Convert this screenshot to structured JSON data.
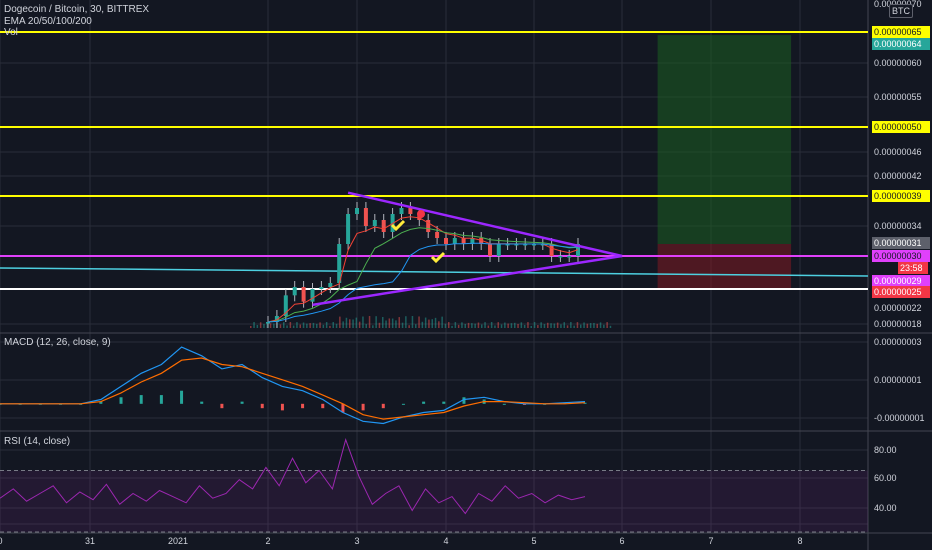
{
  "header": {
    "title": "Dogecoin / Bitcoin, 30, BITTREX",
    "vol_label": "Vol",
    "ema_label": "EMA 20/50/100/200",
    "currency": "BTC"
  },
  "indicators": {
    "macd_label": "MACD (12, 26, close, 9)",
    "rsi_label": "RSI (14, close)"
  },
  "colors": {
    "background": "#131722",
    "grid": "#2a2e39",
    "yellow_level": "#ffff00",
    "magenta_level": "#e040fb",
    "white_level": "#ffffff",
    "cyan_level": "#4dd0e1",
    "triangle": "#9c27ff",
    "macd_line": "#2196f3",
    "signal_line": "#ff6d00",
    "rsi_line": "#9c27b0",
    "profit_zone": "#1b5e20",
    "loss_zone": "#801922"
  },
  "chart_data": [
    {
      "type": "line",
      "pane": "price",
      "title": "Dogecoin / Bitcoin, 30, BITTREX",
      "x_ticks": [
        "0",
        "31",
        "2021",
        "2",
        "3",
        "4",
        "5",
        "6",
        "7",
        "8"
      ],
      "y_ticks": [
        "0.00000070",
        "0.00000060",
        "0.00000055",
        "0.00000046",
        "0.00000042",
        "0.00000034",
        "0.00000022",
        "0.00000018"
      ],
      "ylim": [
        1.8e-07,
        7e-07
      ],
      "horizontal_levels": [
        {
          "value": 6.5e-07,
          "label": "0.00000065",
          "color": "#ffff00"
        },
        {
          "value": 5e-07,
          "label": "0.00000050",
          "color": "#ffff00"
        },
        {
          "value": 3.9e-07,
          "label": "0.00000039",
          "color": "#ffff00"
        },
        {
          "value": 3e-07,
          "label": "0.00000030",
          "color": "#e040fb"
        },
        {
          "value": 2.5e-07,
          "label": "0.00000025",
          "color": "#ffffff"
        }
      ],
      "price_tags": [
        {
          "label": "0.00000064",
          "color": "#26a69a"
        },
        {
          "label": "0.00000031",
          "color": "#5d606b"
        },
        {
          "label": "0.00000030",
          "color": "#f23645"
        },
        {
          "label": "23:58",
          "color": "#f23645"
        },
        {
          "label": "0.00000029",
          "color": "#e040fb"
        },
        {
          "label": "0.00000025",
          "color": "#f23645"
        }
      ],
      "price_series": [
        {
          "x": 2.0,
          "y": 1.85e-07
        },
        {
          "x": 2.1,
          "y": 2e-07
        },
        {
          "x": 2.2,
          "y": 2.4e-07
        },
        {
          "x": 2.3,
          "y": 2.6e-07
        },
        {
          "x": 2.4,
          "y": 2.3e-07
        },
        {
          "x": 2.5,
          "y": 2.5e-07
        },
        {
          "x": 2.6,
          "y": 2.6e-07
        },
        {
          "x": 2.7,
          "y": 2.8e-07
        },
        {
          "x": 2.8,
          "y": 3.1e-07
        },
        {
          "x": 2.9,
          "y": 3.6e-07
        },
        {
          "x": 3.0,
          "y": 3.7e-07
        },
        {
          "x": 3.1,
          "y": 3.4e-07
        },
        {
          "x": 3.2,
          "y": 3.5e-07
        },
        {
          "x": 3.3,
          "y": 3.3e-07
        },
        {
          "x": 3.4,
          "y": 3.6e-07
        },
        {
          "x": 3.5,
          "y": 3.7e-07
        },
        {
          "x": 3.6,
          "y": 3.6e-07
        },
        {
          "x": 3.7,
          "y": 3.5e-07
        },
        {
          "x": 3.8,
          "y": 3.3e-07
        },
        {
          "x": 3.9,
          "y": 3.2e-07
        },
        {
          "x": 4.0,
          "y": 3.1e-07
        },
        {
          "x": 4.1,
          "y": 3.2e-07
        },
        {
          "x": 4.2,
          "y": 3.1e-07
        },
        {
          "x": 4.3,
          "y": 3.2e-07
        },
        {
          "x": 4.4,
          "y": 3.1e-07
        },
        {
          "x": 4.5,
          "y": 3e-07
        },
        {
          "x": 4.6,
          "y": 3.1e-07
        },
        {
          "x": 4.7,
          "y": 3.1e-07
        },
        {
          "x": 4.8,
          "y": 3.1e-07
        },
        {
          "x": 4.9,
          "y": 3.1e-07
        },
        {
          "x": 5.0,
          "y": 3.1e-07
        },
        {
          "x": 5.1,
          "y": 3.1e-07
        },
        {
          "x": 5.2,
          "y": 3e-07
        },
        {
          "x": 5.3,
          "y": 3e-07
        },
        {
          "x": 5.4,
          "y": 3e-07
        },
        {
          "x": 5.5,
          "y": 3.1e-07
        }
      ],
      "triangle": [
        {
          "x": 2.9,
          "y": 3.95e-07
        },
        {
          "x": 6.0,
          "y": 3e-07
        },
        {
          "x": 2.5,
          "y": 2.25e-07
        }
      ],
      "target_zone": {
        "x_start": 6.4,
        "x_end": 7.9,
        "top": 6.45e-07,
        "entry": 3.1e-07,
        "stop": 2.55e-07
      }
    },
    {
      "type": "line",
      "pane": "macd",
      "title": "MACD (12, 26, close, 9)",
      "y_ticks": [
        "0.00000003",
        "0.00000001",
        "-0.00000001"
      ],
      "ylim": [
        -1.2e-08,
        3.2e-08
      ],
      "series": [
        {
          "name": "",
          "values": [
            0,
            0,
            0,
            0,
            0,
            0.2,
            0.8,
            1.4,
            1.8,
            2.6,
            2.2,
            1.6,
            1.8,
            1.2,
            0.8,
            0.6,
            0.2,
            -0.4,
            -0.8,
            -0.9,
            -0.6,
            -0.4,
            -0.3,
            0.2,
            0.3,
            0.1,
            0,
            0,
            0.05,
            0.1
          ]
        },
        {
          "name": "",
          "values": [
            0,
            0,
            0,
            0,
            0,
            0.1,
            0.5,
            1.0,
            1.4,
            2.0,
            2.1,
            1.8,
            1.7,
            1.4,
            1.1,
            0.8,
            0.4,
            0,
            -0.5,
            -0.7,
            -0.6,
            -0.5,
            -0.4,
            -0.1,
            0.1,
            0.1,
            0.05,
            0,
            0,
            0.05
          ]
        }
      ]
    },
    {
      "type": "line",
      "pane": "rsi",
      "title": "RSI (14, close)",
      "y_ticks": [
        "80.00",
        "60.00",
        "40.00"
      ],
      "ylim": [
        30,
        95
      ],
      "series": [
        {
          "name": "",
          "values": [
            52,
            58,
            50,
            55,
            60,
            49,
            56,
            51,
            61,
            48,
            55,
            50,
            57,
            53,
            49,
            60,
            52,
            55,
            64,
            58,
            72,
            60,
            78,
            62,
            70,
            58,
            90,
            66,
            48,
            55,
            60,
            44,
            58,
            49,
            53,
            42,
            55,
            50,
            60,
            52,
            55,
            49,
            54,
            51,
            53
          ]
        }
      ]
    }
  ]
}
